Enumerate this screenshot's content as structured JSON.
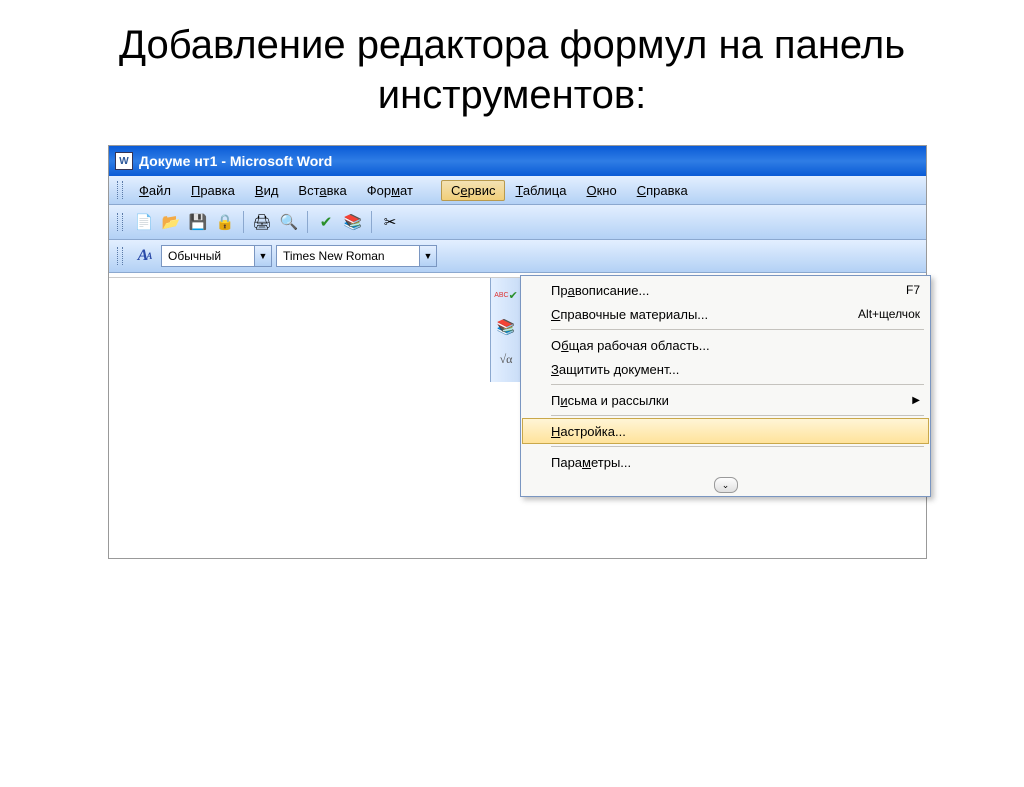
{
  "slide": {
    "title": "Добавление редактора формул на панель инструментов:"
  },
  "window": {
    "title": "Докуме нт1 - Microsoft Word",
    "icon_letter": "W"
  },
  "menubar": {
    "items": [
      {
        "pre": "",
        "u": "Ф",
        "post": "айл"
      },
      {
        "pre": "",
        "u": "П",
        "post": "равка"
      },
      {
        "pre": "",
        "u": "В",
        "post": "ид"
      },
      {
        "pre": "Вст",
        "u": "а",
        "post": "вка"
      },
      {
        "pre": "Фор",
        "u": "м",
        "post": "ат"
      },
      {
        "pre": "С",
        "u": "е",
        "post": "рвис"
      },
      {
        "pre": "",
        "u": "Т",
        "post": "аблица"
      },
      {
        "pre": "",
        "u": "О",
        "post": "кно"
      },
      {
        "pre": "",
        "u": "С",
        "post": "правка"
      }
    ],
    "active_index": 5
  },
  "toolbar": {
    "new": "📄",
    "open": "📂",
    "save": "💾",
    "perm": "🔒",
    "print": "🖨",
    "preview": "🔍",
    "spell": "✔",
    "research": "📚",
    "cut": "✂"
  },
  "format_bar": {
    "style_icon": "A",
    "style_combo": "Обычный",
    "font_combo": "Times New Roman"
  },
  "side_icons": {
    "spell": "✔",
    "research": "📚",
    "formula": "√α"
  },
  "dropdown": {
    "items": [
      {
        "pre": "Пр",
        "u": "а",
        "post": "вописание...",
        "shortcut": "F7",
        "type": "item"
      },
      {
        "pre": "",
        "u": "С",
        "post": "правочные материалы...",
        "shortcut": "Alt+щелчок",
        "type": "item"
      },
      {
        "type": "sep"
      },
      {
        "pre": "О",
        "u": "б",
        "post": "щая рабочая область...",
        "shortcut": "",
        "type": "item"
      },
      {
        "pre": "",
        "u": "З",
        "post": "ащитить документ...",
        "shortcut": "",
        "type": "item"
      },
      {
        "type": "sep"
      },
      {
        "pre": "П",
        "u": "и",
        "post": "сьма и рассылки",
        "shortcut": "",
        "type": "submenu"
      },
      {
        "type": "sep"
      },
      {
        "pre": "",
        "u": "Н",
        "post": "астройка...",
        "shortcut": "",
        "type": "item",
        "highlight": true
      },
      {
        "type": "sep"
      },
      {
        "pre": "Пара",
        "u": "м",
        "post": "етры...",
        "shortcut": "",
        "type": "item"
      }
    ],
    "expand_glyph": "⌄"
  }
}
